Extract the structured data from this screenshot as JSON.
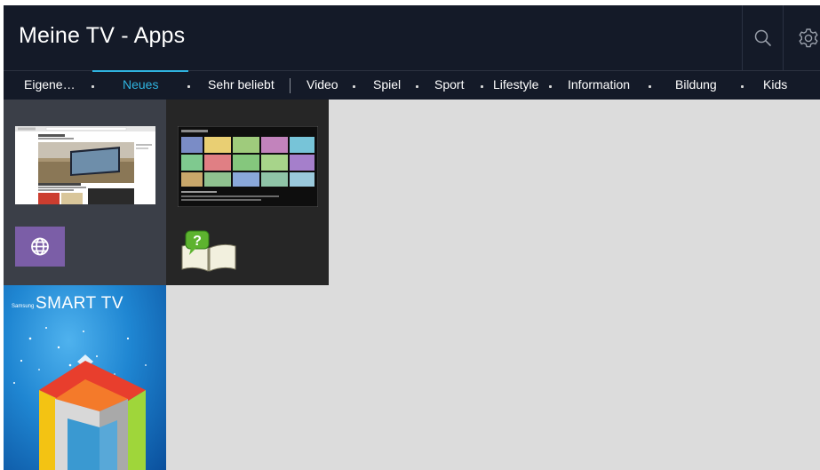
{
  "header": {
    "title": "Meine TV - Apps",
    "icons": [
      "search-icon",
      "gear-icon"
    ]
  },
  "nav": {
    "tabs": [
      "Eigene…",
      "Neues",
      "Sehr beliebt",
      "Video",
      "Spiel",
      "Sport",
      "Lifestyle",
      "Information",
      "Bildung",
      "Kids"
    ],
    "active_tab": "Neues"
  },
  "tiles": {
    "browser": {
      "icon": "globe-icon"
    },
    "manual": {
      "icon": "manual-book-icon"
    },
    "smart_tv": {
      "brand": "Samsung",
      "logo_text": "SMART TV"
    }
  },
  "colors": {
    "header_bg": "#141a28",
    "accent": "#2fb3df",
    "content_bg": "#dcdcdc",
    "browser_tile": "#3b3f48",
    "manual_tile": "#262626",
    "globe_icon_bg": "#7b5ea7"
  }
}
